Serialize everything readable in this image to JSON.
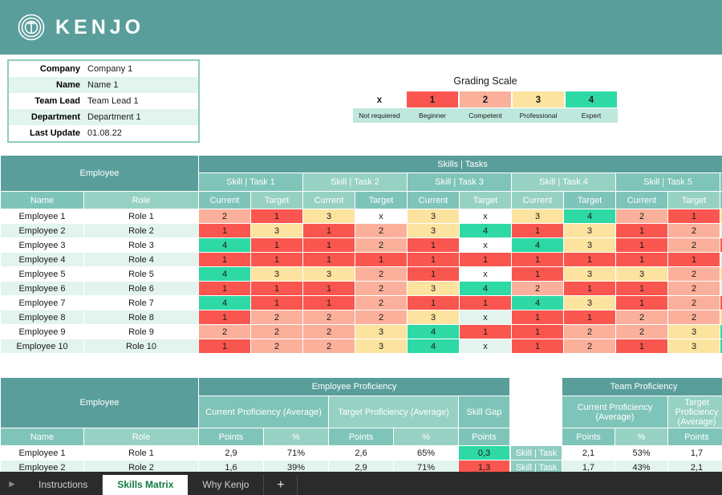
{
  "brand": {
    "name": "KENJO",
    "logo_icon": "kenjo-spiral-icon",
    "bar_color": "#5a9e9b"
  },
  "info_box": {
    "rows": [
      {
        "label": "Company",
        "value": "Company 1"
      },
      {
        "label": "Name",
        "value": "Name 1"
      },
      {
        "label": "Team Lead",
        "value": "Team Lead 1"
      },
      {
        "label": "Department",
        "value": "Department 1"
      },
      {
        "label": "Last Update",
        "value": "01.08.22"
      }
    ]
  },
  "grading_scale": {
    "title": "Grading Scale",
    "levels": [
      {
        "value": "x",
        "label": "Not requiered",
        "color": "#ffffff"
      },
      {
        "value": "1",
        "label": "Beginner",
        "color": "#f9564f"
      },
      {
        "value": "2",
        "label": "Competent",
        "color": "#fbb09c"
      },
      {
        "value": "3",
        "label": "Professional",
        "color": "#fde3a0"
      },
      {
        "value": "4",
        "label": "Expert",
        "color": "#2ed9a5"
      }
    ]
  },
  "skills_matrix": {
    "employee_group": "Employee",
    "skills_group": "Skills | Tasks",
    "col_name": "Name",
    "col_role": "Role",
    "col_current": "Current",
    "col_target": "Target",
    "skills": [
      "Skill | Task 1",
      "Skill | Task 2",
      "Skill | Task 3",
      "Skill | Task 4",
      "Skill | Task 5"
    ],
    "rows": [
      {
        "name": "Employee 1",
        "role": "Role 1",
        "values": [
          "2",
          "1",
          "3",
          "x",
          "3",
          "x",
          "3",
          "4",
          "2",
          "1"
        ]
      },
      {
        "name": "Employee 2",
        "role": "Role 2",
        "values": [
          "1",
          "3",
          "1",
          "2",
          "3",
          "4",
          "1",
          "3",
          "1",
          "2"
        ]
      },
      {
        "name": "Employee 3",
        "role": "Role 3",
        "values": [
          "4",
          "1",
          "1",
          "2",
          "1",
          "x",
          "4",
          "3",
          "1",
          "2"
        ]
      },
      {
        "name": "Employee 4",
        "role": "Role 4",
        "values": [
          "1",
          "1",
          "1",
          "1",
          "1",
          "1",
          "1",
          "1",
          "1",
          "1"
        ]
      },
      {
        "name": "Employee 5",
        "role": "Role 5",
        "values": [
          "4",
          "3",
          "3",
          "2",
          "1",
          "x",
          "1",
          "3",
          "3",
          "2"
        ]
      },
      {
        "name": "Employee 6",
        "role": "Role 6",
        "values": [
          "1",
          "1",
          "1",
          "2",
          "3",
          "4",
          "2",
          "1",
          "1",
          "2"
        ]
      },
      {
        "name": "Employee 7",
        "role": "Role 7",
        "values": [
          "4",
          "1",
          "1",
          "2",
          "1",
          "1",
          "4",
          "3",
          "1",
          "2"
        ]
      },
      {
        "name": "Employee 8",
        "role": "Role 8",
        "values": [
          "1",
          "2",
          "2",
          "2",
          "3",
          "x",
          "1",
          "1",
          "2",
          "2"
        ]
      },
      {
        "name": "Employee 9",
        "role": "Role 9",
        "values": [
          "2",
          "2",
          "2",
          "3",
          "4",
          "1",
          "1",
          "2",
          "2",
          "3"
        ]
      },
      {
        "name": "Employee 10",
        "role": "Role 10",
        "values": [
          "1",
          "2",
          "2",
          "3",
          "4",
          "x",
          "1",
          "2",
          "1",
          "3"
        ]
      }
    ]
  },
  "employee_proficiency": {
    "employee_group": "Employee",
    "title": "Employee Proficiency",
    "col_current": "Current  Proficiency (Average)",
    "col_target": "Target Proficiency (Average)",
    "col_gap": "Skill Gap",
    "col_name": "Name",
    "col_role": "Role",
    "col_points": "Points",
    "col_percent": "%",
    "rows": [
      {
        "name": "Employee 1",
        "role": "Role 1",
        "current_points": "2,9",
        "current_pct": "71%",
        "target_points": "2,6",
        "target_pct": "65%",
        "gap": "0,3",
        "gap_state": "positive"
      },
      {
        "name": "Employee 2",
        "role": "Role 2",
        "current_points": "1,6",
        "current_pct": "39%",
        "target_points": "2,9",
        "target_pct": "71%",
        "gap": "1,3",
        "gap_state": "negative"
      }
    ]
  },
  "team_proficiency": {
    "title": "Team Proficiency",
    "col_current": "Current  Proficiency (Average)",
    "col_target": "Target Proficiency (Average)",
    "col_points": "Points",
    "col_percent": "%",
    "rows": [
      {
        "label": "Skill | Task",
        "current_points": "2,1",
        "current_pct": "53%",
        "target_points": "1,7"
      },
      {
        "label": "Skill | Task",
        "current_points": "1,7",
        "current_pct": "43%",
        "target_points": "2,1"
      }
    ]
  },
  "sheet_tabs": {
    "nav_icon": "play-right-icon",
    "tabs": [
      {
        "label": "Instructions",
        "active": false
      },
      {
        "label": "Skills Matrix",
        "active": true
      },
      {
        "label": "Why Kenjo",
        "active": false
      }
    ],
    "add_label": "+"
  }
}
